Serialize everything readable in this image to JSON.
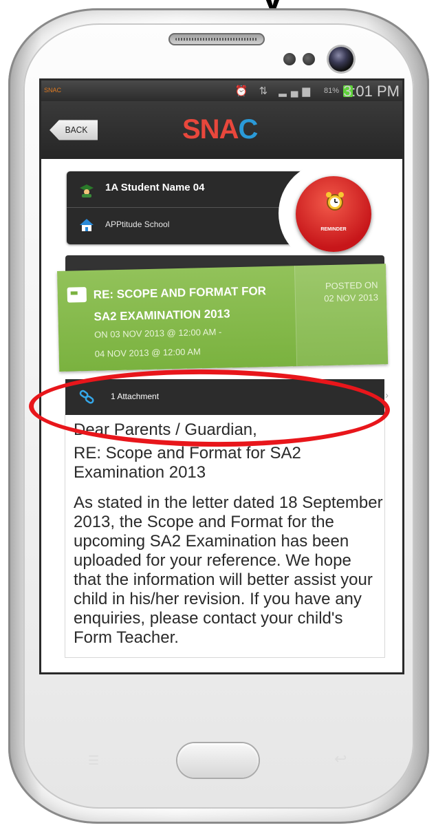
{
  "header_fragment": "y",
  "status_bar": {
    "app": "SNAC",
    "battery_pct": "81%",
    "time": "3:01 PM"
  },
  "app_bar": {
    "back_label": "BACK",
    "logo_part1": "SNA",
    "logo_part2": "C"
  },
  "student_card": {
    "student_name": "1A Student Name 04",
    "school_name": "APPtitude School",
    "reminder_label": "REMINDER"
  },
  "message": {
    "title": "RE: SCOPE AND FORMAT FOR SA2 EXAMINATION 2013",
    "schedule_start": "ON 03 NOV 2013 @ 12:00 AM -",
    "schedule_end": "04 NOV 2013 @ 12:00 AM",
    "posted_label": "POSTED ON",
    "posted_date": "02 NOV 2013",
    "attachment_label": "1 Attachment",
    "greeting": "Dear Parents / Guardian,",
    "subject": "RE: Scope and Format for SA2 Examination 2013",
    "body": "As stated in the letter dated 18 September 2013, the Scope and Format for the upcoming SA2 Examination has been uploaded for your reference. We hope that the information will better assist your child in his/her revision. If you have any enquiries, please contact your child's Form Teacher."
  },
  "colors": {
    "annotation": "#e8161b",
    "message_green": "#7ab23f",
    "reminder_red": "#c7161a",
    "logo_red": "#e8473c",
    "logo_blue": "#2a9ad8"
  }
}
